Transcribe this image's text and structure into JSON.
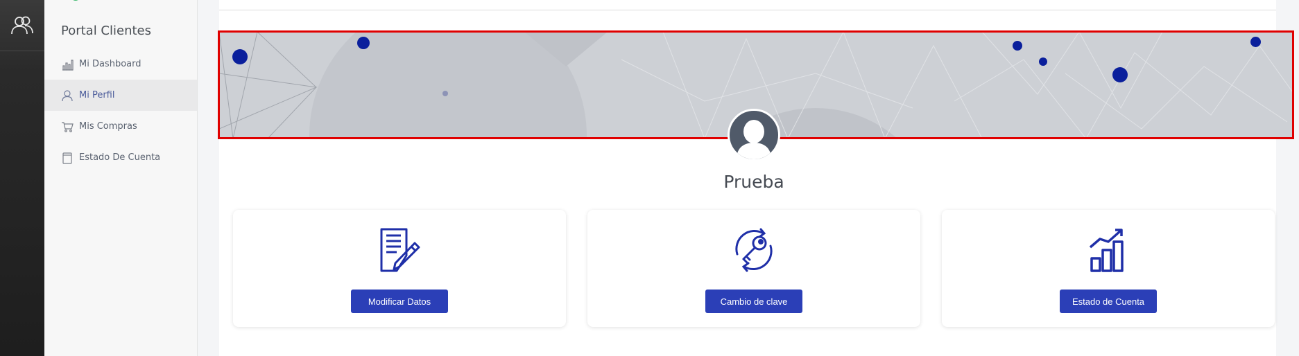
{
  "sidebar": {
    "title": "Portal Clientes",
    "items": [
      {
        "label": "Mi Dashboard",
        "icon": "bar-chart-icon",
        "active": false
      },
      {
        "label": "Mi Perfil",
        "icon": "user-icon",
        "active": true
      },
      {
        "label": "Mis Compras",
        "icon": "cart-icon",
        "active": false
      },
      {
        "label": "Estado De Cuenta",
        "icon": "document-icon",
        "active": false
      }
    ]
  },
  "profile": {
    "name": "Prueba"
  },
  "cards": [
    {
      "button_label": "Modificar Datos",
      "icon": "edit-document-icon"
    },
    {
      "button_label": "Cambio de clave",
      "icon": "key-reset-icon"
    },
    {
      "button_label": "Estado de Cuenta",
      "icon": "growth-chart-icon"
    }
  ],
  "colors": {
    "accent": "#2b3fb7",
    "icon_blue": "#1f2fa8",
    "highlight_border": "#e00000",
    "rail": "#222222",
    "banner": "#cdd0d5"
  }
}
